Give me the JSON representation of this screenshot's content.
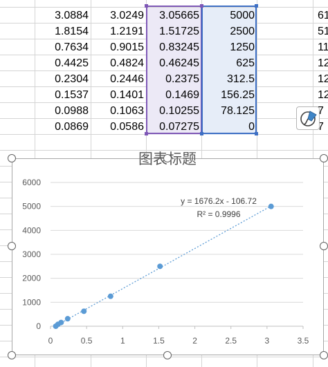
{
  "sheet": {
    "rows": [
      {
        "a": "3.0884",
        "b": "3.0249",
        "c": "3.05665",
        "d": "5000",
        "e": "61"
      },
      {
        "a": "1.8154",
        "b": "1.2191",
        "c": "1.51725",
        "d": "2500",
        "e": "51"
      },
      {
        "a": "0.7634",
        "b": "0.9015",
        "c": "0.83245",
        "d": "1250",
        "e": "11"
      },
      {
        "a": "0.4425",
        "b": "0.4824",
        "c": "0.46245",
        "d": "625",
        "e": "12"
      },
      {
        "a": "0.2304",
        "b": "0.2446",
        "c": "0.2375",
        "d": "312.5",
        "e": "12"
      },
      {
        "a": "0.1537",
        "b": "0.1401",
        "c": "0.1469",
        "d": "156.25",
        "e": "12"
      },
      {
        "a": "0.0988",
        "b": "0.1063",
        "c": "0.10255",
        "d": "78.125",
        "e": "7"
      },
      {
        "a": "0.0869",
        "b": "0.0586",
        "c": "0.07275",
        "d": "0",
        "e": "7"
      }
    ],
    "colors": {
      "selection_c": "#7e57b6",
      "selection_d": "#3d6fc4"
    }
  },
  "quick_analysis_icon": "paintbrush-icon",
  "chart_data": {
    "type": "scatter",
    "title": "图表标题",
    "xlabel": "",
    "ylabel": "",
    "xlim": [
      0,
      3.5
    ],
    "ylim": [
      0,
      6000
    ],
    "x_ticks": [
      "0",
      "0.5",
      "1",
      "1.5",
      "2",
      "2.5",
      "3",
      "3.5"
    ],
    "y_ticks": [
      "0",
      "1000",
      "2000",
      "3000",
      "4000",
      "5000",
      "6000"
    ],
    "grid": "horizontal",
    "series": [
      {
        "points": [
          {
            "x": 3.05665,
            "y": 5000
          },
          {
            "x": 1.51725,
            "y": 2500
          },
          {
            "x": 0.83245,
            "y": 1250
          },
          {
            "x": 0.46245,
            "y": 625
          },
          {
            "x": 0.2375,
            "y": 312.5
          },
          {
            "x": 0.1469,
            "y": 156.25
          },
          {
            "x": 0.10255,
            "y": 78.125
          },
          {
            "x": 0.07275,
            "y": 0
          }
        ],
        "color": "#5b9bd5"
      }
    ],
    "trendline": {
      "type": "linear",
      "slope": 1676.2,
      "intercept": -106.72,
      "equation": "y = 1676.2x - 106.72",
      "r_squared": "R² = 0.9996",
      "style": "dotted"
    }
  }
}
